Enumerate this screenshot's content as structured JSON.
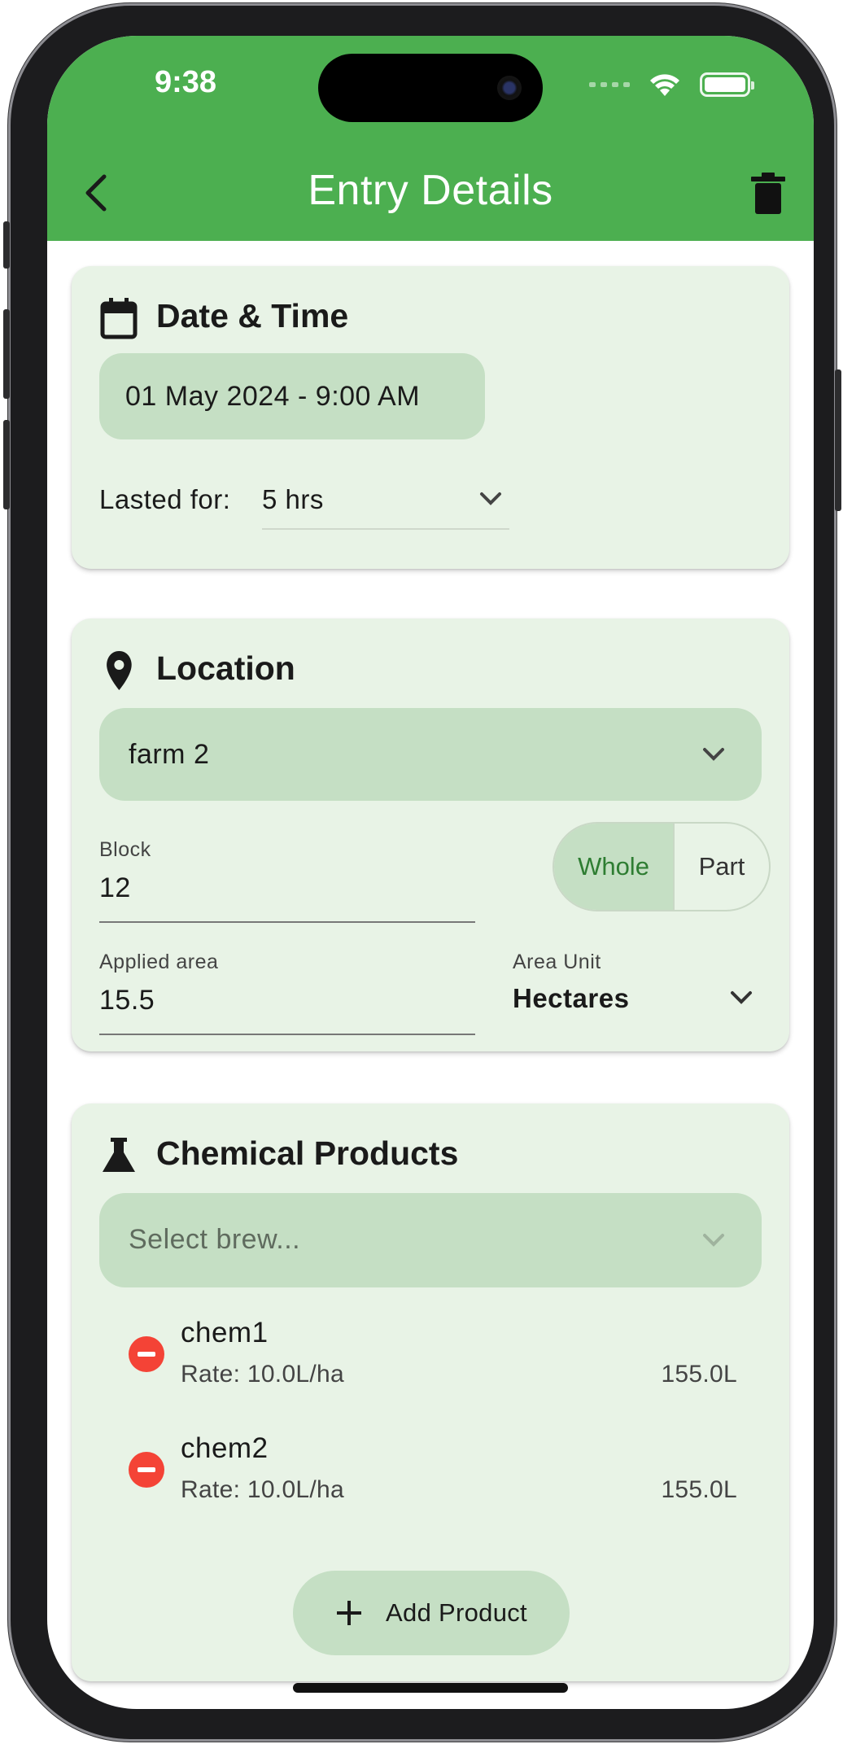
{
  "status_bar": {
    "time": "9:38"
  },
  "header": {
    "title": "Entry Details",
    "back_icon": "chevron-left-icon",
    "delete_icon": "trash-icon",
    "background_color": "#4caf50"
  },
  "date_time": {
    "title": "Date & Time",
    "icon": "calendar-icon",
    "date_value": "01 May 2024 - 9:00 AM",
    "duration_label": "Lasted for:",
    "duration_value": "5 hrs"
  },
  "location": {
    "title": "Location",
    "icon": "location-pin-icon",
    "farm_value": "farm 2",
    "block_label": "Block",
    "block_value": "12",
    "segment_options": [
      "Whole",
      "Part"
    ],
    "segment_selected": "Whole",
    "area_label": "Applied area",
    "area_value": "15.5",
    "unit_label": "Area Unit",
    "unit_value": "Hectares"
  },
  "chemicals": {
    "title": "Chemical Products",
    "icon": "flask-icon",
    "brew_placeholder": "Select brew...",
    "products": [
      {
        "name": "chem1",
        "rate": "Rate: 10.0L/ha",
        "total": "155.0L"
      },
      {
        "name": "chem2",
        "rate": "Rate: 10.0L/ha",
        "total": "155.0L"
      }
    ],
    "add_label": "Add Product"
  },
  "colors": {
    "accent": "#4caf50",
    "card_bg": "#e8f3e6",
    "pill_bg": "#c5dfc4",
    "remove": "#f44336",
    "selected_text": "#2e7d32"
  }
}
